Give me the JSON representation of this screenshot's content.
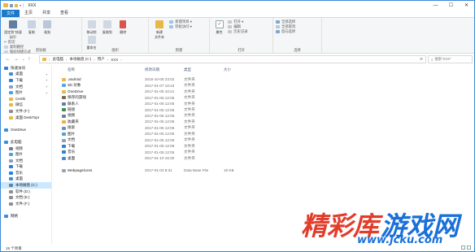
{
  "titlebar": {
    "title": "XXX",
    "minimize": "—",
    "maximize": "☐",
    "close": "✕"
  },
  "tabs": [
    "文件",
    "主页",
    "共享",
    "查看"
  ],
  "ribbon": {
    "clipboard": {
      "label": "剪贴板",
      "pin": "固定到\"快速访问\"",
      "copy": "复制",
      "paste": "粘贴",
      "cut": "✂ 剪切",
      "copy_path": "复制路径",
      "paste_shortcut": "粘贴快捷方式"
    },
    "organize": {
      "label": "组织",
      "move_to": "移动到",
      "copy_to": "复制到",
      "delete": "删除",
      "rename": "重命名"
    },
    "new": {
      "label": "新建",
      "new_folder": "新建\n文件夹",
      "new_item": "新建项目 ▾",
      "easy_access": "轻松访问 ▾"
    },
    "open": {
      "label": "打开",
      "properties": "属性",
      "open": "打开 ▾",
      "edit": "编辑",
      "history": "历史记录"
    },
    "select": {
      "label": "选择",
      "select_all": "全部选择",
      "select_none": "全部取消",
      "invert": "反向选择"
    }
  },
  "address": {
    "back": "←",
    "forward": "→",
    "up_menu": "⌄",
    "up": "↑",
    "crumbs": [
      "此电脑",
      "本地磁盘 (C:)",
      "用户",
      "XXX"
    ],
    "refresh": "⟳",
    "search_placeholder": "搜索\"XXX\""
  },
  "nav_pane": [
    {
      "label": "快速访问",
      "icon": "star-icon",
      "color": "#2f7fd6",
      "indent": 4,
      "pin": ""
    },
    {
      "label": "桌面",
      "icon": "desktop-icon",
      "color": "#3a8fd9",
      "indent": 10,
      "pin": "✦"
    },
    {
      "label": "下载",
      "icon": "download-icon",
      "color": "#2f7fd6",
      "indent": 10,
      "pin": "✦"
    },
    {
      "label": "文档",
      "icon": "document-icon",
      "color": "#8aa2bf",
      "indent": 10,
      "pin": "✦"
    },
    {
      "label": "图片",
      "icon": "picture-icon",
      "color": "#4aa3df",
      "indent": 10,
      "pin": "✦"
    },
    {
      "label": "CeShi",
      "icon": "folder-icon",
      "color": "#e8b846",
      "indent": 10,
      "pin": ""
    },
    {
      "label": "微信",
      "icon": "folder-icon",
      "color": "#e8b846",
      "indent": 10,
      "pin": ""
    },
    {
      "label": "文件 (F:)",
      "icon": "drive-icon",
      "color": "#8f8f8f",
      "indent": 10,
      "pin": ""
    },
    {
      "label": "桌面 DeskTopI",
      "icon": "folder-icon",
      "color": "#e8b846",
      "indent": 10,
      "pin": ""
    },
    {
      "label": "",
      "icon": "",
      "color": "",
      "indent": 0,
      "pin": ""
    },
    {
      "label": "OneDrive",
      "icon": "cloud-icon",
      "color": "#3a8fd9",
      "indent": 4,
      "pin": ""
    },
    {
      "label": "",
      "icon": "",
      "color": "",
      "indent": 0,
      "pin": ""
    },
    {
      "label": "此电脑",
      "icon": "computer-icon",
      "color": "#3a8fd9",
      "indent": 4,
      "pin": ""
    },
    {
      "label": "视频",
      "icon": "video-icon",
      "color": "#6b7f99",
      "indent": 10,
      "pin": ""
    },
    {
      "label": "图片",
      "icon": "picture-icon",
      "color": "#4aa3df",
      "indent": 10,
      "pin": ""
    },
    {
      "label": "文档",
      "icon": "document-icon",
      "color": "#8aa2bf",
      "indent": 10,
      "pin": ""
    },
    {
      "label": "下载",
      "icon": "download-icon",
      "color": "#2f7fd6",
      "indent": 10,
      "pin": ""
    },
    {
      "label": "音乐",
      "icon": "music-icon",
      "color": "#2f7fd6",
      "indent": 10,
      "pin": ""
    },
    {
      "label": "桌面",
      "icon": "desktop-icon",
      "color": "#3a8fd9",
      "indent": 10,
      "pin": ""
    },
    {
      "label": "本地磁盘 (C:)",
      "icon": "drive-icon",
      "color": "#6b7f99",
      "indent": 10,
      "pin": "",
      "selected": true
    },
    {
      "label": "软件 (D:)",
      "icon": "drive-icon",
      "color": "#8f8f8f",
      "indent": 10,
      "pin": ""
    },
    {
      "label": "文档 (E:)",
      "icon": "drive-icon",
      "color": "#8f8f8f",
      "indent": 10,
      "pin": ""
    },
    {
      "label": "文件 (F:)",
      "icon": "drive-icon",
      "color": "#8f8f8f",
      "indent": 10,
      "pin": ""
    },
    {
      "label": "",
      "icon": "",
      "color": "",
      "indent": 0,
      "pin": ""
    },
    {
      "label": "网络",
      "icon": "network-icon",
      "color": "#3a8fd9",
      "indent": 4,
      "pin": ""
    }
  ],
  "columns": {
    "name": "名称",
    "date": "修改日期",
    "type": "类型",
    "size": "大小"
  },
  "files": [
    {
      "name": ".android",
      "date": "2016-10-05 23:02",
      "type": "文件夹",
      "size": "",
      "icon": "folder-icon",
      "color": "#e8b846"
    },
    {
      "name": "3D 对象",
      "date": "2017-01-07 10:23",
      "type": "文件夹",
      "size": "",
      "icon": "3d-objects-icon",
      "color": "#59a5e6"
    },
    {
      "name": "OneDrive",
      "date": "2017-01-05 10:21",
      "type": "文件夹",
      "size": "",
      "icon": "cloud-folder-icon",
      "color": "#e8b846"
    },
    {
      "name": "保存的游戏",
      "date": "2017-01-05 12:05",
      "type": "文件夹",
      "size": "",
      "icon": "saved-games-icon",
      "color": "#7a6a55"
    },
    {
      "name": "联系人",
      "date": "2017-01-05 12:05",
      "type": "文件夹",
      "size": "",
      "icon": "contacts-icon",
      "color": "#5d7fa8"
    },
    {
      "name": "链接",
      "date": "2017-01-05 12:05",
      "type": "文件夹",
      "size": "",
      "icon": "links-icon",
      "color": "#3c8f4a"
    },
    {
      "name": "视频",
      "date": "2017-01-05 12:05",
      "type": "文件夹",
      "size": "",
      "icon": "video-icon",
      "color": "#6b7f99"
    },
    {
      "name": "收藏夹",
      "date": "2017-01-05 12:05",
      "type": "文件夹",
      "size": "",
      "icon": "favorites-icon",
      "color": "#e3b33b"
    },
    {
      "name": "搜索",
      "date": "2017-01-05 12:05",
      "type": "文件夹",
      "size": "",
      "icon": "search-folder-icon",
      "color": "#6f8fb0"
    },
    {
      "name": "图片",
      "date": "2017-01-05 12:05",
      "type": "文件夹",
      "size": "",
      "icon": "picture-icon",
      "color": "#4aa3df"
    },
    {
      "name": "文档",
      "date": "2017-01-05 12:05",
      "type": "文件夹",
      "size": "",
      "icon": "document-icon",
      "color": "#8aa2bf"
    },
    {
      "name": "下载",
      "date": "2017-01-05 12:05",
      "type": "文件夹",
      "size": "",
      "icon": "download-icon",
      "color": "#2f7fd6"
    },
    {
      "name": "音乐",
      "date": "2017-01-05 12:05",
      "type": "文件夹",
      "size": "",
      "icon": "music-icon",
      "color": "#2f7fd6"
    },
    {
      "name": "桌面",
      "date": "2017-01-10 16:30",
      "type": "文件夹",
      "size": "",
      "icon": "desktop-icon",
      "color": "#3a8fd9"
    },
    {
      "name": "",
      "date": "",
      "type": "",
      "size": "",
      "icon": "",
      "color": ""
    },
    {
      "name": "Webpagelcons",
      "date": "2017-01-03 8:31",
      "type": "Data Base File",
      "size": "15 KB",
      "icon": "database-file-icon",
      "color": "#9aa5b3"
    }
  ],
  "status": {
    "count": "15 个项目"
  },
  "watermark": {
    "part1": "精彩库",
    "part2": "游戏网",
    "url": "www.jcku.com"
  }
}
